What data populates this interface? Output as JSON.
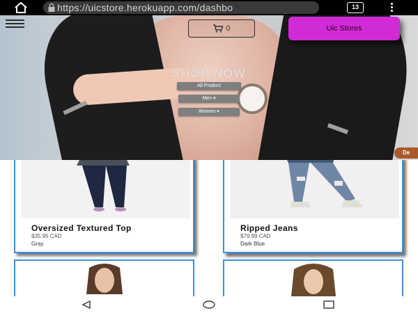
{
  "browser": {
    "url": "https://uicstore.herokuapp.com/dashbo",
    "tab_count": "13",
    "home_icon": "home-icon",
    "lock_icon": "lock-icon",
    "more_icon": "more-vertical-icon"
  },
  "hero": {
    "heading": "SHOP NOW",
    "menu_icon": "hamburger-menu-icon",
    "cart": {
      "icon": "cart-icon",
      "count": "0"
    },
    "store_button": "Uic Stores",
    "nav": {
      "all_products": "All Product",
      "men": "Men ▾",
      "women": "Women ▾"
    },
    "chat_badge": "De"
  },
  "products": [
    {
      "name": "Oversized Textured Top",
      "price": "$35.95 CAD",
      "color": "Gray"
    },
    {
      "name": "Ripped Jeans",
      "price": "$79.99 CAD",
      "color": "Dark Blue"
    }
  ],
  "system_nav": {
    "back_icon": "back-triangle-icon",
    "home_icon": "home-circle-icon",
    "recents_icon": "recents-square-icon"
  },
  "colors": {
    "store_button": "#d12bd6",
    "card_border": "#3d8ee0",
    "browser_bar": "#000000"
  }
}
